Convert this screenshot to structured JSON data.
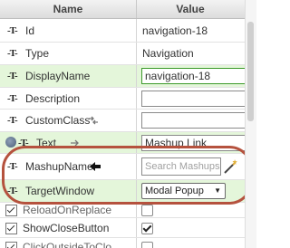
{
  "header": {
    "name_col": "Name",
    "value_col": "Value"
  },
  "properties": [
    {
      "label": "Id",
      "type_icon": "string-type-icon",
      "value": "navigation-18",
      "kind": "text"
    },
    {
      "label": "Type",
      "type_icon": "string-type-icon",
      "value": "Navigation",
      "kind": "text"
    },
    {
      "label": "DisplayName",
      "type_icon": "string-type-icon",
      "value": "navigation-18",
      "kind": "input"
    },
    {
      "label": "Description",
      "type_icon": "string-type-icon",
      "value": "",
      "kind": "input"
    },
    {
      "label": "CustomClass",
      "type_icon": "string-type-icon",
      "value": "",
      "kind": "input"
    },
    {
      "label": "Text",
      "type_icon": "string-type-icon",
      "value": "Mashup Link",
      "kind": "input"
    },
    {
      "label": "MashupName",
      "type_icon": "string-type-icon",
      "placeholder": "Search Mashups",
      "kind": "search"
    },
    {
      "label": "TargetWindow",
      "type_icon": "string-type-icon",
      "value": "Modal Popup",
      "kind": "select"
    },
    {
      "label": "ReloadOnReplace",
      "type_icon": "boolean-type-icon",
      "checked": false,
      "kind": "checkbox"
    },
    {
      "label": "ShowCloseButton",
      "type_icon": "boolean-type-icon",
      "checked": true,
      "kind": "checkbox"
    },
    {
      "label": "ClickOutsideToClo",
      "type_icon": "boolean-type-icon",
      "checked": false,
      "kind": "checkbox"
    }
  ],
  "colors": {
    "highlight_row": "#e4f6da",
    "highlight_ring": "#b5523e",
    "input_green_border": "#3c9a2a"
  }
}
